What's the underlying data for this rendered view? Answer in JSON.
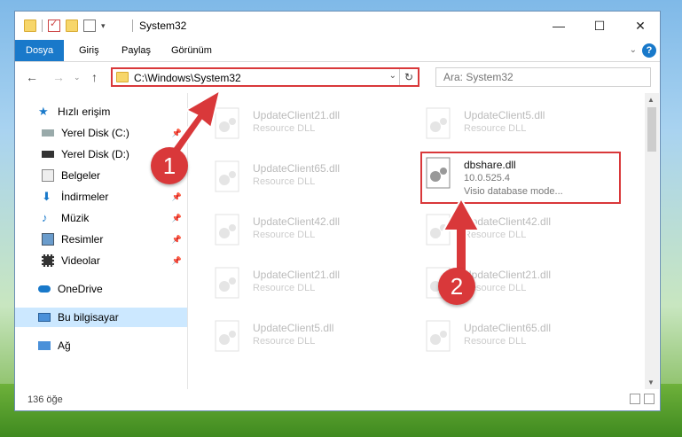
{
  "window": {
    "title": "System32",
    "controls": {
      "minimize": "—",
      "maximize": "☐",
      "close": "✕"
    }
  },
  "ribbon": {
    "tabs": [
      {
        "label": "Dosya",
        "active": true
      },
      {
        "label": "Giriş"
      },
      {
        "label": "Paylaş"
      },
      {
        "label": "Görünüm"
      }
    ],
    "help": "?"
  },
  "address": {
    "path": "C:\\Windows\\System32",
    "search_placeholder": "Ara: System32"
  },
  "nav": {
    "items": [
      {
        "label": "Hızlı erişim",
        "icon": "star-icon"
      },
      {
        "label": "Yerel Disk (C:)",
        "icon": "drive-icon",
        "pinned": true
      },
      {
        "label": "Yerel Disk (D:)",
        "icon": "drive-icon"
      },
      {
        "label": "Belgeler",
        "icon": "documents-icon",
        "pinned": true
      },
      {
        "label": "İndirmeler",
        "icon": "download-icon",
        "pinned": true
      },
      {
        "label": "Müzik",
        "icon": "music-icon",
        "pinned": true
      },
      {
        "label": "Resimler",
        "icon": "pictures-icon",
        "pinned": true
      },
      {
        "label": "Videolar",
        "icon": "videos-icon",
        "pinned": true
      },
      {
        "label": "OneDrive",
        "icon": "cloud-icon"
      },
      {
        "label": "Bu bilgisayar",
        "icon": "computer-icon",
        "selected": true
      },
      {
        "label": "Ağ",
        "icon": "network-icon"
      }
    ]
  },
  "files": [
    {
      "name": "UpdateClient21.dll",
      "desc": "Resource DLL"
    },
    {
      "name": "UpdateClient5.dll",
      "desc": "Resource DLL"
    },
    {
      "name": "UpdateClient65.dll",
      "desc": "Resource DLL"
    },
    {
      "name": "dbshare.dll",
      "version": "10.0.525.4",
      "desc": "Visio database mode...",
      "highlighted": true
    },
    {
      "name": "UpdateClient42.dll",
      "desc": "Resource DLL"
    },
    {
      "name": "UpdateClient42.dll",
      "desc": "Resource DLL"
    },
    {
      "name": "UpdateClient21.dll",
      "desc": "Resource DLL"
    },
    {
      "name": "UpdateClient21.dll",
      "desc": "Resource DLL"
    },
    {
      "name": "UpdateClient5.dll",
      "desc": "Resource DLL"
    },
    {
      "name": "UpdateClient65.dll",
      "desc": "Resource DLL"
    }
  ],
  "status": {
    "count": "136 öğe"
  },
  "annotations": {
    "badge1": "1",
    "badge2": "2"
  },
  "colors": {
    "accent": "#1979ca",
    "highlight": "#d9383a"
  }
}
